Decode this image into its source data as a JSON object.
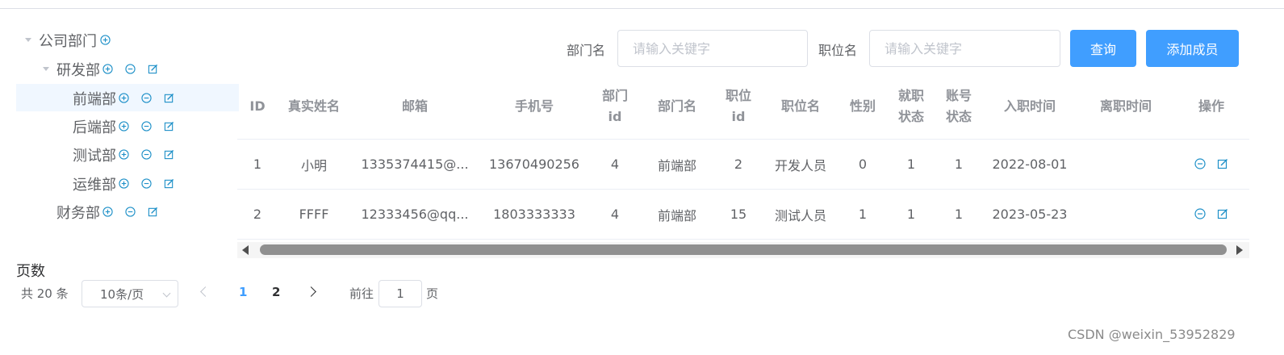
{
  "colors": {
    "primary": "#409eff",
    "icon": "#1e90c8",
    "header_text": "#909399",
    "body_text": "#606266"
  },
  "tree": [
    {
      "label": "公司部门",
      "level": 0,
      "expanded": true,
      "actions": [
        "plus-circle-icon"
      ]
    },
    {
      "label": "研发部",
      "level": 1,
      "expanded": true,
      "actions": [
        "plus-circle-icon",
        "minus-circle-icon",
        "edit-icon"
      ]
    },
    {
      "label": "前端部",
      "level": 2,
      "selected": true,
      "actions": [
        "plus-circle-icon",
        "minus-circle-icon",
        "edit-icon"
      ]
    },
    {
      "label": "后端部",
      "level": 2,
      "actions": [
        "plus-circle-icon",
        "minus-circle-icon",
        "edit-icon"
      ]
    },
    {
      "label": "测试部",
      "level": 2,
      "actions": [
        "plus-circle-icon",
        "minus-circle-icon",
        "edit-icon"
      ]
    },
    {
      "label": "运维部",
      "level": 2,
      "actions": [
        "plus-circle-icon",
        "minus-circle-icon",
        "edit-icon"
      ]
    },
    {
      "label": "财务部",
      "level": 1,
      "actions": [
        "plus-circle-icon",
        "minus-circle-icon",
        "edit-icon"
      ]
    }
  ],
  "search": {
    "dept_label": "部门名",
    "dept_placeholder": "请输入关键字",
    "pos_label": "职位名",
    "pos_placeholder": "请输入关键字",
    "query_button": "查询",
    "add_button": "添加成员"
  },
  "table": {
    "columns": [
      "ID",
      "真实姓名",
      "邮箱",
      "手机号",
      "部门\nid",
      "部门名",
      "职位\nid",
      "职位名",
      "性别",
      "就职\n状态",
      "账号\n状态",
      "入职时间",
      "离职时间",
      "操作"
    ],
    "rows": [
      [
        "1",
        "小明",
        "1335374415@...",
        "13670490256",
        "4",
        "前端部",
        "2",
        "开发人员",
        "0",
        "1",
        "1",
        "2022-08-01",
        ""
      ],
      [
        "2",
        "FFFF",
        "12333456@qq...",
        "1803333333",
        "4",
        "前端部",
        "15",
        "测试人员",
        "1",
        "1",
        "1",
        "2023-05-23",
        ""
      ]
    ],
    "row_actions": [
      "minus-circle-icon",
      "edit-icon"
    ]
  },
  "pagination": {
    "title": "页数",
    "total": "共 20 条",
    "page_size": "10条/页",
    "pages": [
      "1",
      "2"
    ],
    "current": "1",
    "goto_label": "前往",
    "goto_value": "1",
    "page_suffix": "页"
  },
  "watermark": "CSDN @weixin_53952829"
}
